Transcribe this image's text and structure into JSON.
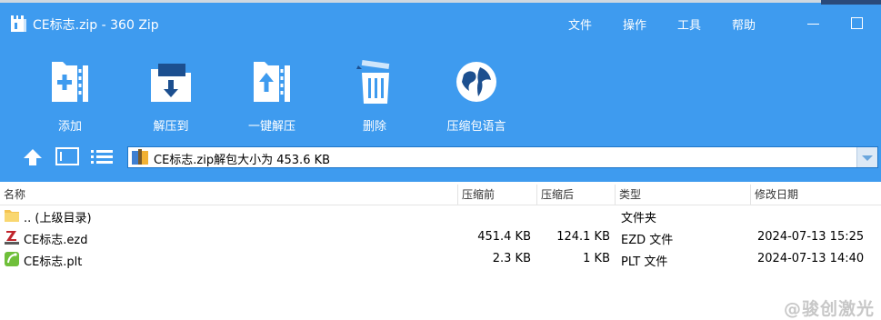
{
  "window": {
    "title": "CE标志.zip - 360 Zip",
    "menu": [
      "文件",
      "操作",
      "工具",
      "帮助"
    ]
  },
  "toolbar": {
    "add": "添加",
    "extract_to": "解压到",
    "one_click_extract": "一键解压",
    "delete": "删除",
    "language_pack": "压缩包语言"
  },
  "path_bar": {
    "text": "CE标志.zip解包大小为 453.6 KB"
  },
  "columns": {
    "name": "名称",
    "compressed_before": "压缩前",
    "compressed_after": "压缩后",
    "type": "类型",
    "modified": "修改日期"
  },
  "files": [
    {
      "name": ".. (上级目录)",
      "before": "",
      "after": "",
      "type": "文件夹",
      "modified": "",
      "icon": "folder-icon"
    },
    {
      "name": "CE标志.ezd",
      "before": "451.4 KB",
      "after": "124.1 KB",
      "type": "EZD 文件",
      "modified": "2024-07-13 15:25",
      "icon": "ezcad-file-icon"
    },
    {
      "name": "CE标志.plt",
      "before": "2.3 KB",
      "after": "1 KB",
      "type": "PLT 文件",
      "modified": "2024-07-13 14:40",
      "icon": "plt-file-icon"
    }
  ],
  "watermark": "@骏创激光",
  "colors": {
    "accent": "#3e9bef",
    "path_border": "#1f76c8"
  }
}
